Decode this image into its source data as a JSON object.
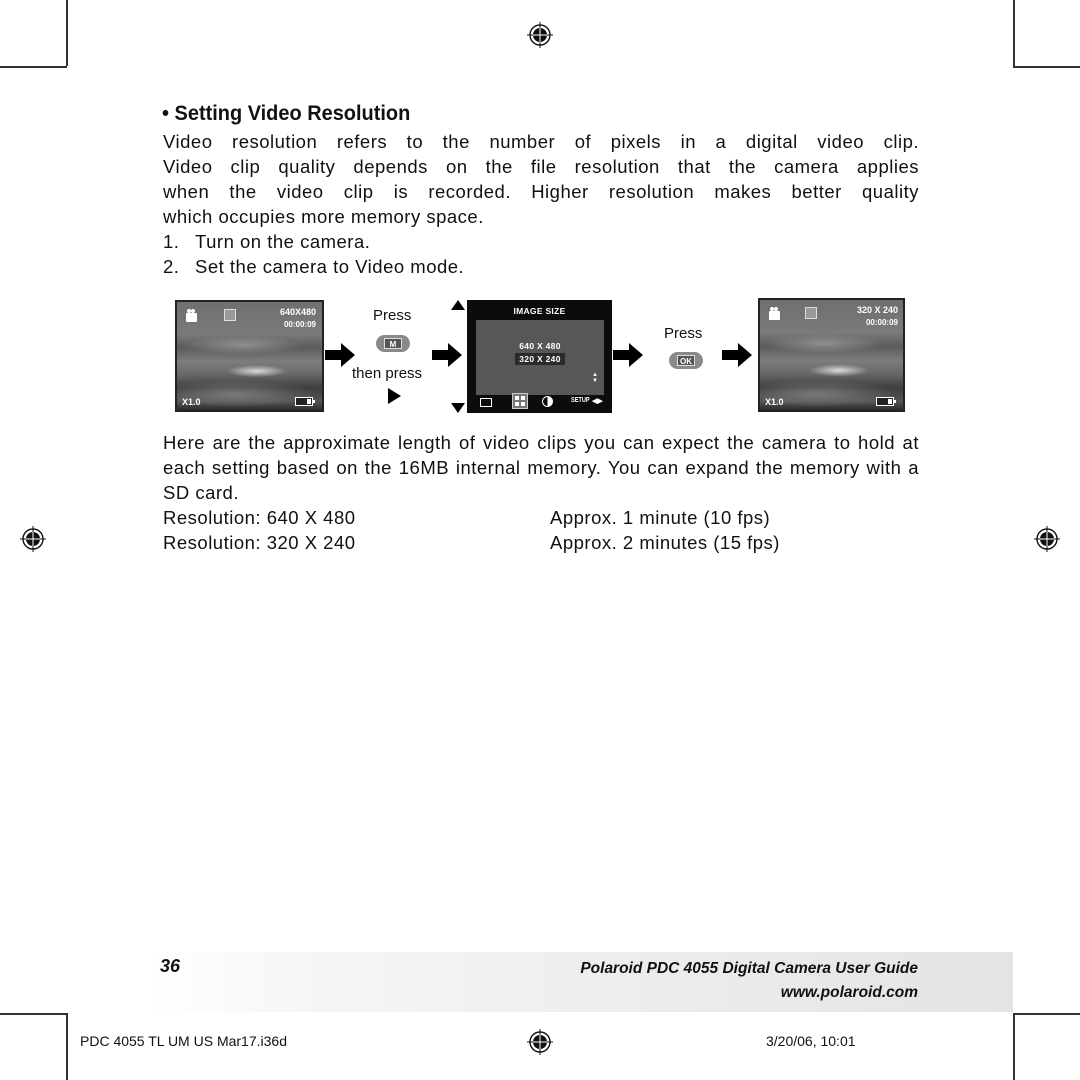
{
  "section": {
    "bullet": "•",
    "heading": "Setting Video Resolution"
  },
  "intro": {
    "paragraph_lines": [
      "Video resolution refers to the number of pixels in a digital video clip.",
      "Video clip quality depends on the file resolution that the camera applies",
      "when the video clip is recorded. Higher resolution makes better quality",
      "which occupies more memory space."
    ]
  },
  "steps": [
    {
      "num": "1.",
      "text": "Turn on the camera."
    },
    {
      "num": "2.",
      "text": "Set the camera to Video mode."
    }
  ],
  "diagram": {
    "screen_before": {
      "resolution": "640X480",
      "time": "00:00:09",
      "zoom": "X1.0",
      "icons": [
        "video-camera-icon",
        "af-icon",
        "battery-icon"
      ]
    },
    "step1": {
      "press_label": "Press",
      "button_label": "M",
      "then_label": "then press",
      "direction_icon": "right-triangle-icon"
    },
    "menu_screen": {
      "title": "IMAGE SIZE",
      "options": [
        "640 X 480",
        "320 X 240"
      ],
      "selected": "320 X 240",
      "bottom_icons": [
        "camera-mode-icon",
        "image-size-icon",
        "contrast-icon",
        "setup-icon",
        "left-right-icon"
      ],
      "setup_label": "SETUP"
    },
    "step2": {
      "press_label": "Press",
      "button_label": "OK"
    },
    "screen_after": {
      "resolution": "320 X 240",
      "time": "00:00:09",
      "zoom": "X1.0"
    }
  },
  "capacity": {
    "paragraph": "Here are the approximate length of video clips you can expect the camera to hold at each setting based on the 16MB internal memory. You can expand the memory with a SD card.",
    "rows": [
      {
        "resolution": "Resolution: 640 X 480",
        "duration": "Approx. 1 minute (10 fps)"
      },
      {
        "resolution": "Resolution: 320 X 240",
        "duration": "Approx. 2 minutes (15 fps)"
      }
    ]
  },
  "footer": {
    "page_number": "36",
    "guide_title": "Polaroid PDC 4055 Digital Camera User Guide",
    "url": "www.polaroid.com"
  },
  "slug": {
    "filename": "PDC 4055 TL UM US Mar17.i36d",
    "datetime": "3/20/06, 10:01"
  }
}
